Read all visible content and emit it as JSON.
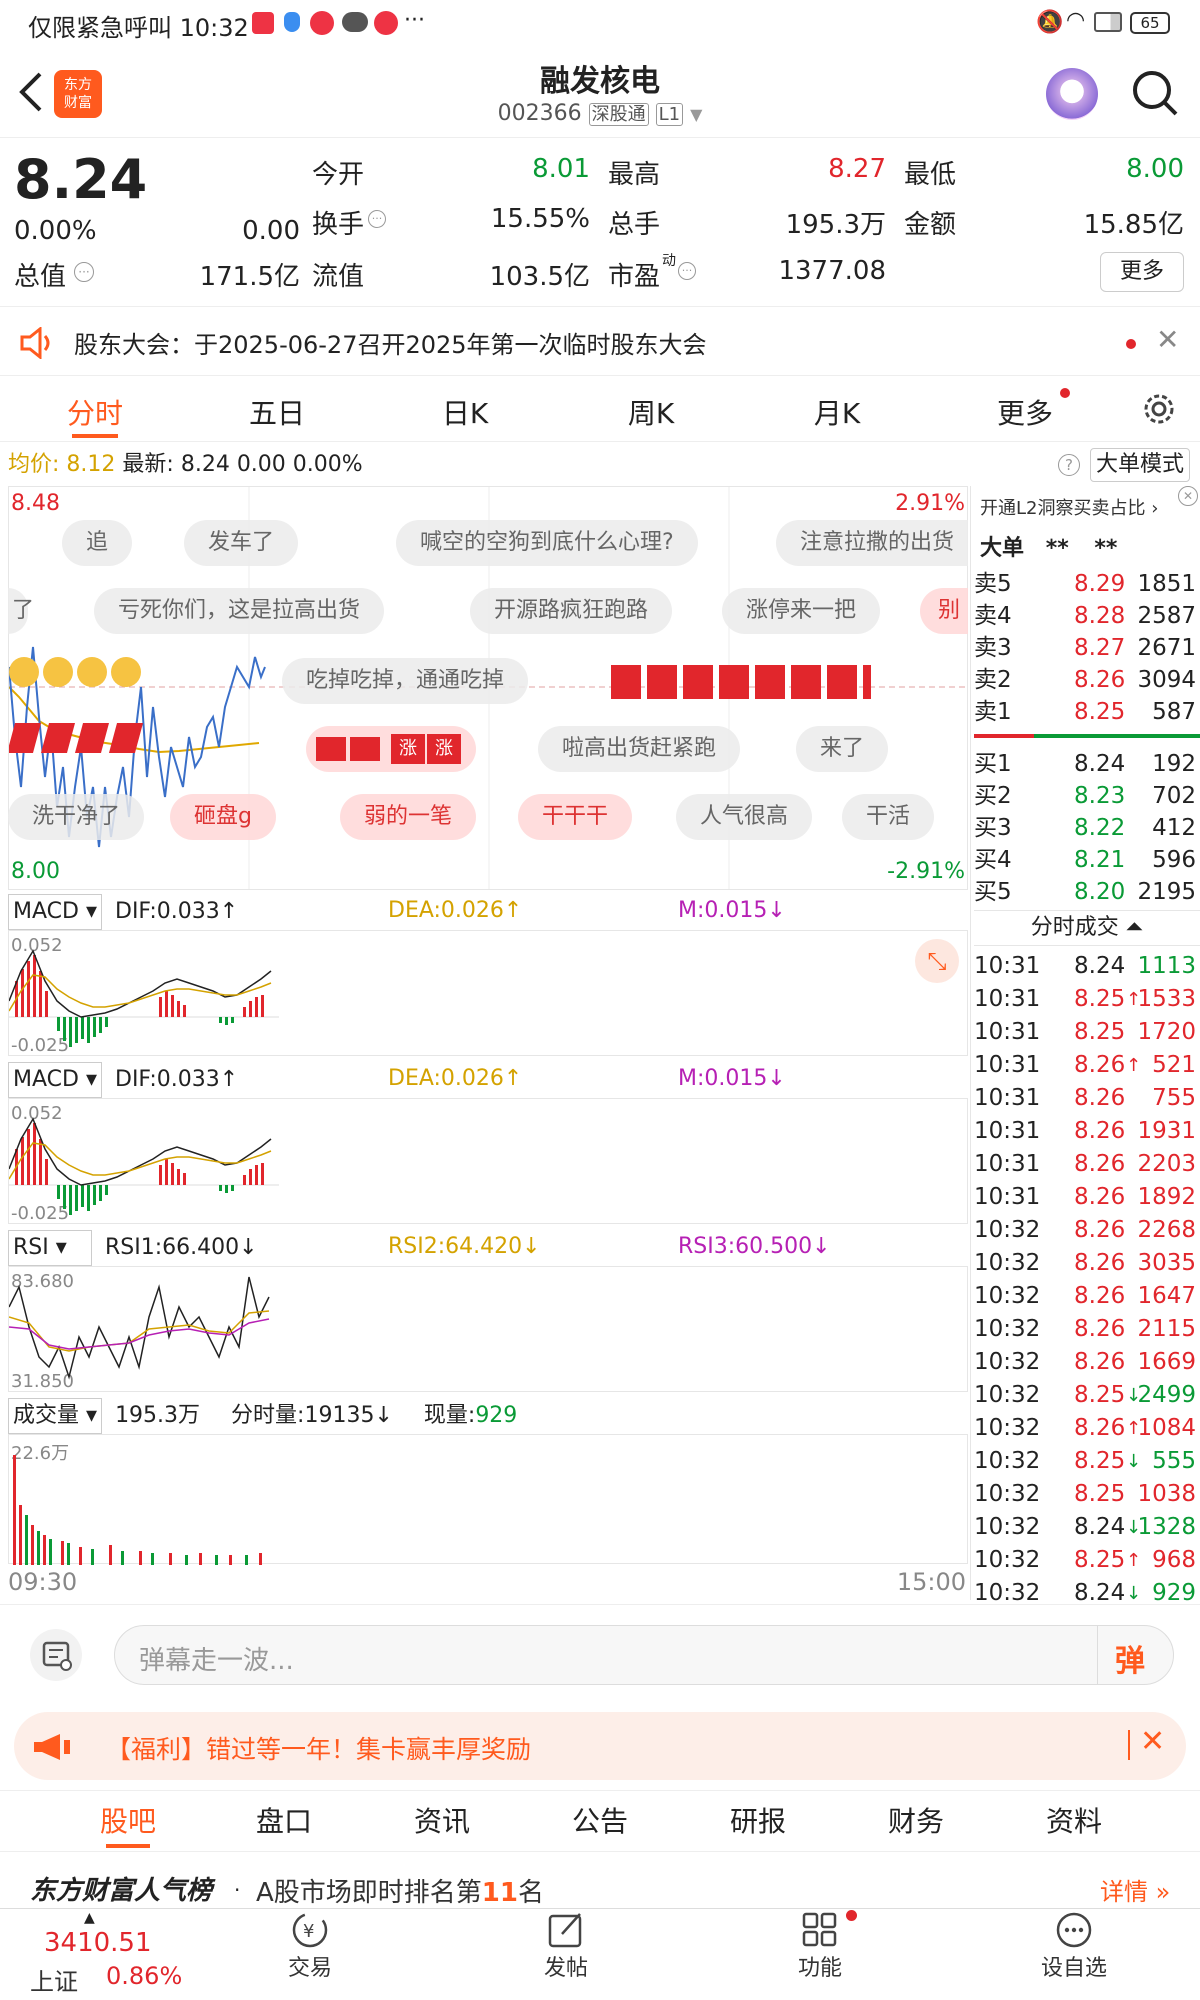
{
  "status_bar": {
    "left_text": "仅限紧急呼叫 10:32",
    "battery": "65"
  },
  "header": {
    "title": "融发核电",
    "code": "002366",
    "badge1": "深股通",
    "badge2": "L1"
  },
  "quote": {
    "price": "8.24",
    "change_pct": "0.00%",
    "change": "0.00",
    "total_value_label": "总值",
    "total_value": "171.5亿",
    "open_label": "今开",
    "open": "8.01",
    "high_label": "最高",
    "high": "8.27",
    "low_label": "最低",
    "low": "8.00",
    "turnover_label": "换手",
    "turnover": "15.55%",
    "volume_label": "总手",
    "volume": "195.3万",
    "amount_label": "金额",
    "amount": "15.85亿",
    "float_label": "流值",
    "float_value": "103.5亿",
    "pe_label": "市盈",
    "pe_sup": "动",
    "pe": "1377.08",
    "more_button": "更多"
  },
  "notice": {
    "text": "股东大会：于2025-06-27召开2025年第一次临时股东大会"
  },
  "chart_tabs": [
    "分时",
    "五日",
    "日K",
    "周K",
    "月K",
    "更多"
  ],
  "info_line": {
    "avg_label": "均价:",
    "avg": "8.12",
    "latest_label": "最新:",
    "latest": "8.24",
    "chg": "0.00",
    "pct": "0.00%",
    "mode_button": "大单模式"
  },
  "price_chart": {
    "y_top": "8.48",
    "y_bottom": "8.00",
    "pct_top": "2.91%",
    "pct_bottom": "-2.91%",
    "time_start": "09:30",
    "time_end": "15:00"
  },
  "danmaku": [
    "追",
    "发车了",
    "喊空的空狗到底什么心理?",
    "注意拉撒的出货",
    "亏死你们，这是拉高出货",
    "开源路疯狂跑路",
    "涨停来一把",
    "别",
    "了",
    "吃掉吃掉，通通吃掉",
    "啦高出货赶紧跑",
    "来了",
    "洗干净了",
    "砸盘g",
    "弱的一笔",
    "干干干",
    "人气很高",
    "干活",
    "涨",
    "涨"
  ],
  "macd1": {
    "label": "MACD",
    "dif": "DIF:0.033",
    "dea": "DEA:0.026",
    "m": "M:0.015",
    "top": "0.052",
    "bottom": "-0.025"
  },
  "macd2": {
    "label": "MACD",
    "dif": "DIF:0.033",
    "dea": "DEA:0.026",
    "m": "M:0.015",
    "top": "0.052",
    "bottom": "-0.025"
  },
  "rsi": {
    "label": "RSI",
    "rsi1": "RSI1:66.400",
    "rsi2": "RSI2:64.420",
    "rsi3": "RSI3:60.500",
    "top": "83.680",
    "bottom": "31.850"
  },
  "volume": {
    "label": "成交量",
    "total": "195.3万",
    "minute": "分时量:19135",
    "now_label": "现量:",
    "now": "929",
    "top": "22.6万"
  },
  "orderbook": {
    "promo": "开通L2洞察买卖占比",
    "big_label": "大单",
    "stars1": "**",
    "stars2": "**",
    "sells": [
      {
        "label": "卖5",
        "price": "8.29",
        "vol": "1851"
      },
      {
        "label": "卖4",
        "price": "8.28",
        "vol": "2587"
      },
      {
        "label": "卖3",
        "price": "8.27",
        "vol": "2671"
      },
      {
        "label": "卖2",
        "price": "8.26",
        "vol": "3094"
      },
      {
        "label": "卖1",
        "price": "8.25",
        "vol": "587"
      }
    ],
    "buys": [
      {
        "label": "买1",
        "price": "8.24",
        "vol": "192"
      },
      {
        "label": "买2",
        "price": "8.23",
        "vol": "702"
      },
      {
        "label": "买3",
        "price": "8.22",
        "vol": "412"
      },
      {
        "label": "买4",
        "price": "8.21",
        "vol": "596"
      },
      {
        "label": "买5",
        "price": "8.20",
        "vol": "2195"
      }
    ],
    "ticks_label": "分时成交",
    "ticks": [
      {
        "t": "10:31",
        "p": "8.24",
        "d": "",
        "v": "1113",
        "pc": "black",
        "vc": "green"
      },
      {
        "t": "10:31",
        "p": "8.25",
        "d": "↑",
        "v": "1533",
        "pc": "red",
        "vc": "red"
      },
      {
        "t": "10:31",
        "p": "8.25",
        "d": "",
        "v": "1720",
        "pc": "red",
        "vc": "red"
      },
      {
        "t": "10:31",
        "p": "8.26",
        "d": "↑",
        "v": "521",
        "pc": "red",
        "vc": "red"
      },
      {
        "t": "10:31",
        "p": "8.26",
        "d": "",
        "v": "755",
        "pc": "red",
        "vc": "red"
      },
      {
        "t": "10:31",
        "p": "8.26",
        "d": "",
        "v": "1931",
        "pc": "red",
        "vc": "red"
      },
      {
        "t": "10:31",
        "p": "8.26",
        "d": "",
        "v": "2203",
        "pc": "red",
        "vc": "red"
      },
      {
        "t": "10:31",
        "p": "8.26",
        "d": "",
        "v": "1892",
        "pc": "red",
        "vc": "red"
      },
      {
        "t": "10:32",
        "p": "8.26",
        "d": "",
        "v": "2268",
        "pc": "red",
        "vc": "red"
      },
      {
        "t": "10:32",
        "p": "8.26",
        "d": "",
        "v": "3035",
        "pc": "red",
        "vc": "red"
      },
      {
        "t": "10:32",
        "p": "8.26",
        "d": "",
        "v": "1647",
        "pc": "red",
        "vc": "red"
      },
      {
        "t": "10:32",
        "p": "8.26",
        "d": "",
        "v": "2115",
        "pc": "red",
        "vc": "red"
      },
      {
        "t": "10:32",
        "p": "8.26",
        "d": "",
        "v": "1669",
        "pc": "red",
        "vc": "red"
      },
      {
        "t": "10:32",
        "p": "8.25",
        "d": "↓",
        "v": "2499",
        "pc": "red",
        "vc": "green"
      },
      {
        "t": "10:32",
        "p": "8.26",
        "d": "↑",
        "v": "1084",
        "pc": "red",
        "vc": "red"
      },
      {
        "t": "10:32",
        "p": "8.25",
        "d": "↓",
        "v": "555",
        "pc": "red",
        "vc": "green"
      },
      {
        "t": "10:32",
        "p": "8.25",
        "d": "",
        "v": "1038",
        "pc": "red",
        "vc": "red"
      },
      {
        "t": "10:32",
        "p": "8.24",
        "d": "↓",
        "v": "1328",
        "pc": "black",
        "vc": "green"
      },
      {
        "t": "10:32",
        "p": "8.25",
        "d": "↑",
        "v": "968",
        "pc": "red",
        "vc": "red"
      },
      {
        "t": "10:32",
        "p": "8.24",
        "d": "↓",
        "v": "929",
        "pc": "black",
        "vc": "green"
      }
    ]
  },
  "comment_bar": {
    "placeholder": "弹幕走一波...",
    "danmu_icon": "弹"
  },
  "welfare": {
    "text": "【福利】错过等一年！集卡赢丰厚奖励"
  },
  "bottom_tabs": [
    "股吧",
    "盘口",
    "资讯",
    "公告",
    "研报",
    "财务",
    "资料"
  ],
  "ranking": {
    "brand": "东方财富人气榜",
    "text_before": "A股市场即时排名第",
    "rank": "11",
    "text_after": "名",
    "detail": "详情"
  },
  "index": {
    "value": "3410.51",
    "name": "上证",
    "pct": "0.86%"
  },
  "bottom_nav": [
    "交易",
    "发帖",
    "功能",
    "设自选"
  ],
  "colors": {
    "up": "#e1262c",
    "down": "#0a9a36",
    "accent": "#ff5a1e",
    "price_line": "#3a6fc8",
    "avg_line": "#e0a800"
  }
}
